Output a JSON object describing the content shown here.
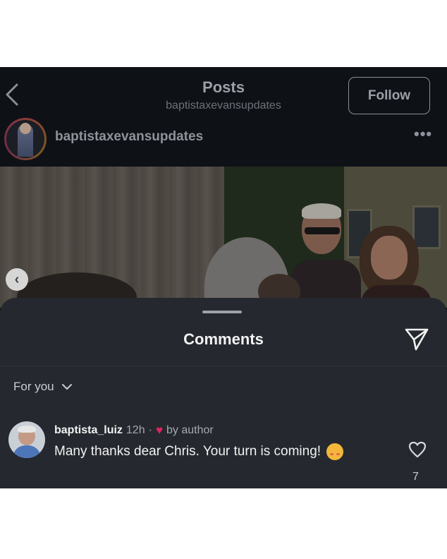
{
  "header": {
    "title": "Posts",
    "subtitle": "baptistaxevansupdates",
    "follow_label": "Follow",
    "back_icon": "chevron-left-icon"
  },
  "post": {
    "username": "baptistaxevansupdates",
    "more_label": "•••",
    "prev_label": "‹"
  },
  "comments": {
    "title": "Comments",
    "filter_label": "For you",
    "items": [
      {
        "username": "baptista_luiz",
        "time": "12h",
        "separator": "·",
        "by_author": "by author",
        "text": "Many thanks dear Chris. Your turn is coming!",
        "emoji": "smiling-face-with-hearts",
        "likes": "7"
      }
    ]
  },
  "colors": {
    "background": "#25292f",
    "heart": "#e0245e",
    "text": "#f1f1f1"
  }
}
